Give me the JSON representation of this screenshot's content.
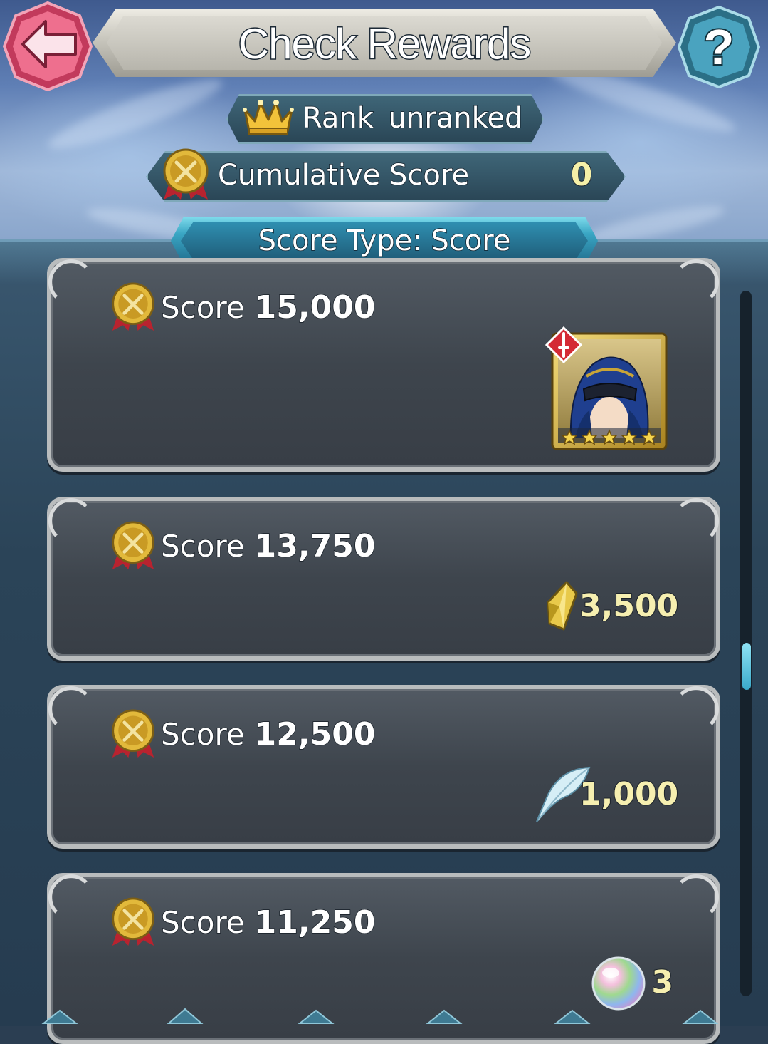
{
  "header": {
    "title": "Check Rewards",
    "back_icon": "left-arrow-icon",
    "help_label": "?"
  },
  "rank": {
    "label": "Rank",
    "value": "unranked"
  },
  "cumulative": {
    "label": "Cumulative Score",
    "value": "0"
  },
  "score_type": {
    "label": "Score Type: Score"
  },
  "rewards": [
    {
      "label": "Score",
      "score": "15,000",
      "reward_icon": "hero-portrait-icon",
      "reward_qty": "",
      "stars": 5
    },
    {
      "label": "Score",
      "score": "13,750",
      "reward_icon": "feather-crystal-icon",
      "reward_qty": "3,500"
    },
    {
      "label": "Score",
      "score": "12,500",
      "reward_icon": "feather-icon",
      "reward_qty": "1,000"
    },
    {
      "label": "Score",
      "score": "11,250",
      "reward_icon": "orb-icon",
      "reward_qty": "3"
    }
  ],
  "colors": {
    "accent": "#3aa6c4",
    "value_text": "#f6efb0",
    "back_button": "#e8587a",
    "help_button": "#3a8aa6"
  }
}
